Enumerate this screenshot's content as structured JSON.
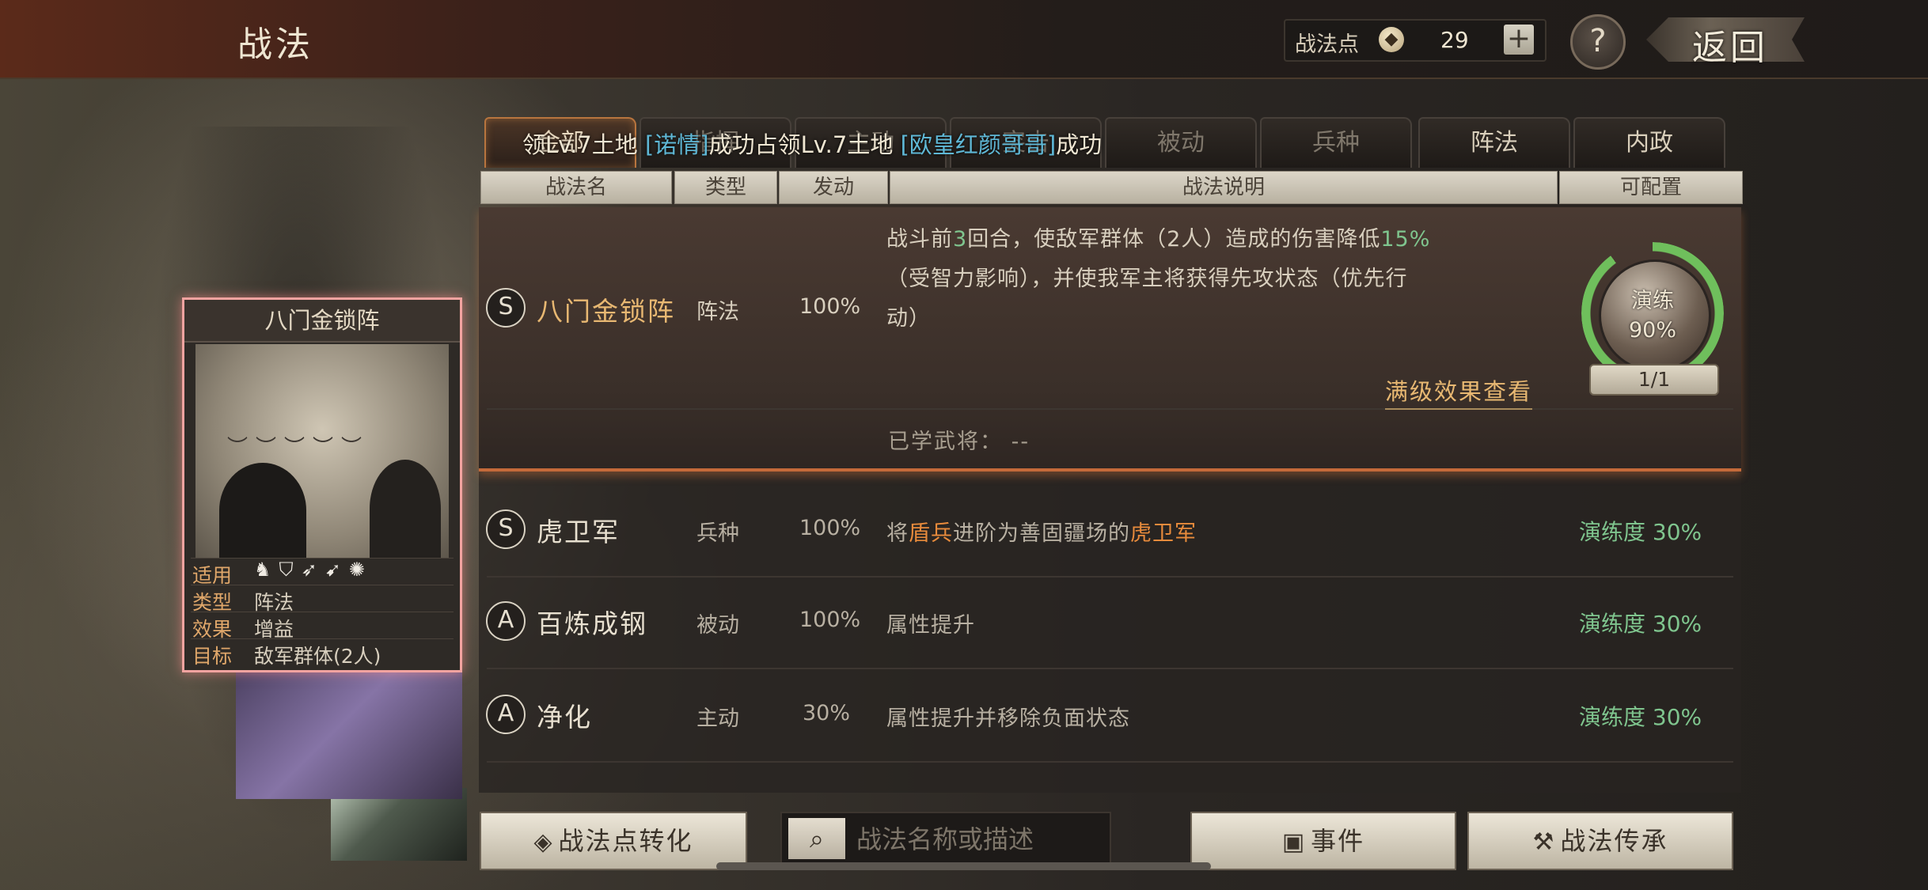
{
  "header": {
    "title": "战法",
    "points_label": "战法点",
    "points_icon": "flame-coin-icon",
    "points_value": "29",
    "add_symbol": "+",
    "help_symbol": "?",
    "back_label": "返回"
  },
  "tabs": [
    {
      "label": "金部"
    },
    {
      "label": "指挥"
    },
    {
      "label": "主动"
    },
    {
      "label": "突击"
    },
    {
      "label": "被动"
    },
    {
      "label": "兵种"
    },
    {
      "label": "阵法"
    },
    {
      "label": "内政"
    }
  ],
  "marquee": {
    "part1": "领Lv.7土地 ",
    "name1": "[诺情]",
    "part2": "成功占领Lv.7土地 ",
    "name2": "[欧皇红颜哥哥]",
    "part3": "成功"
  },
  "columns": {
    "name": "战法名",
    "type": "类型",
    "trigger": "发动",
    "description": "战法说明",
    "configurable": "可配置"
  },
  "selected": {
    "grade": "S",
    "name": "八门金锁阵",
    "type": "阵法",
    "rate": "100%",
    "desc_line1_a": "战斗前",
    "desc_line1_num": "3",
    "desc_line1_b": "回合，使敌军群体（2人）造成的伤害降低",
    "desc_line1_pct": "15%",
    "desc_line2": "（受智力影响），并使我军主将获得先攻状态（优先行",
    "desc_line3": "动）",
    "practice_label": "演练",
    "practice_pct": "90%",
    "practice_value": 0.9,
    "count": "1/1",
    "max_effect_link": "满级效果查看",
    "learned_label": "已学武将：",
    "learned_value": "--"
  },
  "rows": [
    {
      "grade": "S",
      "name": "虎卫军",
      "type": "兵种",
      "rate": "100%",
      "desc_a": "将",
      "desc_hl1": "盾兵",
      "desc_b": "进阶为善固疆场的",
      "desc_hl2": "虎卫军",
      "practice": "演练度 30%"
    },
    {
      "grade": "A",
      "name": "百炼成钢",
      "type": "被动",
      "rate": "100%",
      "desc": "属性提升",
      "practice": "演练度 30%"
    },
    {
      "grade": "A",
      "name": "净化",
      "type": "主动",
      "rate": "30%",
      "desc": "属性提升并移除负面状态",
      "practice": "演练度 30%"
    }
  ],
  "card": {
    "title": "八门金锁阵",
    "suit_label": "适用",
    "type_label": "类型",
    "type_value": "阵法",
    "effect_label": "效果",
    "effect_value": "增益",
    "target_label": "目标",
    "target_value": "敌军群体(2人)",
    "unit_icons": [
      "cavalry-icon",
      "shield-icon",
      "bow-icon",
      "spear-icon",
      "wheel-icon"
    ]
  },
  "bottom": {
    "convert_label": "战法点转化",
    "search_placeholder": "战法名称或描述",
    "event_label": "事件",
    "inherit_label": "战法传承"
  }
}
